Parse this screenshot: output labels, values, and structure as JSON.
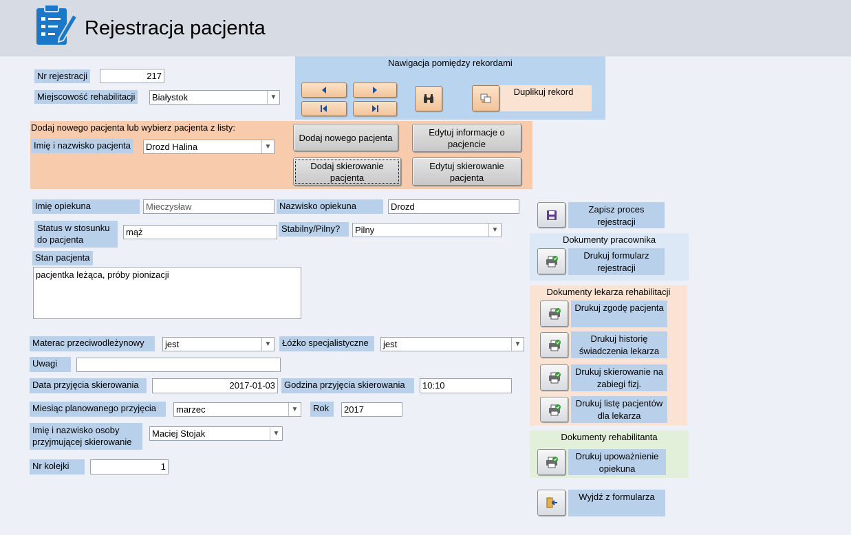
{
  "header": {
    "title": "Rejestracja pacjenta",
    "icon": "clipboard-pen-icon"
  },
  "record": {
    "nr_label": "Nr rejestracji",
    "nr_value": "217",
    "city_label": "Miejscowość rehabilitacji",
    "city_value": "Białystok"
  },
  "nav": {
    "title": "Nawigacja pomiędzy rekordami",
    "duplicate_label": "Duplikuj rekord"
  },
  "patient": {
    "prompt": "Dodaj nowego pacjenta lub wybierz pacjenta z listy:",
    "name_label": "Imię i nazwisko pacjenta",
    "name_value": "Drozd Halina",
    "add_patient": "Dodaj nowego pacjenta",
    "edit_info": "Edytuj informacje o pacjencie",
    "add_referral": "Dodaj skierowanie pacjenta",
    "edit_referral": "Edytuj skierowanie pacjenta"
  },
  "guardian": {
    "first_label": "Imię opiekuna",
    "first_value": "Mieczysław",
    "last_label": "Nazwisko opiekuna",
    "last_value": "Drozd",
    "status_label": "Status w stosunku do pacjenta",
    "status_value": "mąż",
    "stable_label": "Stabilny/Pilny?",
    "stable_value": "Pilny"
  },
  "condition": {
    "label": "Stan pacjenta",
    "value": "pacjentka leżąca, próby pionizacji"
  },
  "details": {
    "mattress_label": "Materac przeciwodleżynowy",
    "mattress_value": "jest",
    "bed_label": "Łóżko specjalistyczne",
    "bed_value": "jest",
    "notes_label": "Uwagi",
    "notes_value": "",
    "date_label": "Data przyjęcia skierowania",
    "date_value": "2017-01-03",
    "hour_label": "Godzina przyjęcia skierowania",
    "hour_value": "10:10",
    "month_label": "Miesiąc planowanego przyjęcia",
    "month_value": "marzec",
    "year_label": "Rok",
    "year_value": "2017",
    "receiver_label": "Imię i nazwisko osoby przyjmującej skierowanie",
    "receiver_value": "Maciej Stojak",
    "queue_label": "Nr kolejki",
    "queue_value": "1"
  },
  "side": {
    "save": "Zapisz proces rejestracji",
    "staff_title": "Dokumenty pracownika",
    "print_registration": "Drukuj formularz rejestracji",
    "doctor_title": "Dokumenty lekarza rehabilitacji",
    "print_consent": "Drukuj zgodę pacjenta",
    "print_history": "Drukuj historię świadczenia lekarza",
    "print_referral": "Drukuj skierowanie na zabiegi fizj.",
    "print_list": "Drukuj listę pacjentów dla lekarza",
    "rehab_title": "Dokumenty rehabilitanta",
    "print_authorization": "Drukuj upoważnienie opiekuna",
    "exit": "Wyjdź z formularza"
  },
  "colors": {
    "nav_panel": "#b9d4ee",
    "patient_panel": "#f8cbad",
    "staff_panel": "#dce8f5",
    "doctor_panel": "#fbe3d3",
    "rehab_panel": "#e2efd9",
    "label_bg": "#b9d0ea"
  }
}
